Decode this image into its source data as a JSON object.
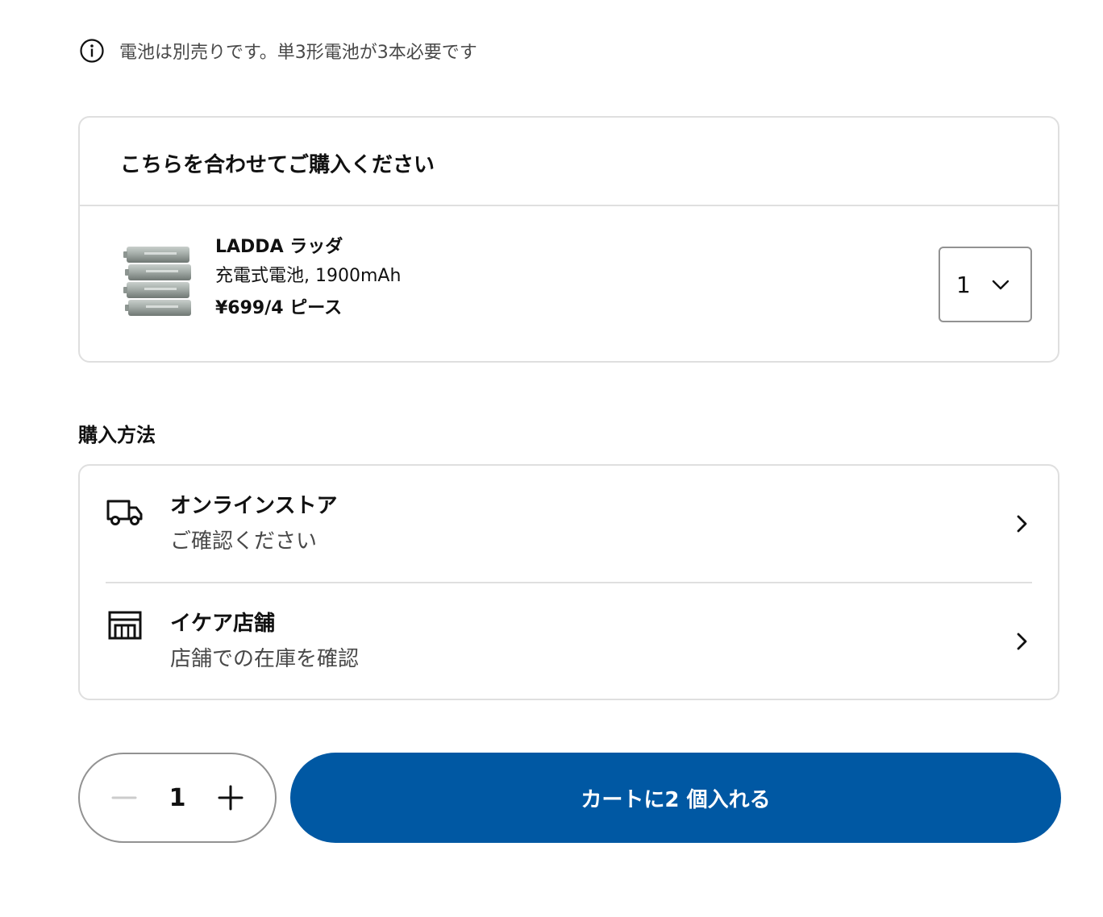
{
  "notice": {
    "icon": "info-icon",
    "text": "電池は別売りです。単3形電池が3本必要です"
  },
  "addon": {
    "title": "こちらを合わせてご購入ください",
    "product": {
      "name": "LADDA ラッダ",
      "description": "充電式電池, 1900mAh",
      "price": "¥699/4 ピース",
      "quantity": "1"
    }
  },
  "purchase": {
    "title": "購入方法",
    "methods": [
      {
        "icon": "truck-icon",
        "title": "オンラインストア",
        "subtitle": "ご確認ください"
      },
      {
        "icon": "store-icon",
        "title": "イケア店舗",
        "subtitle": "店舗での在庫を確認"
      }
    ]
  },
  "cart": {
    "quantity": "1",
    "button_label": "カートに2 個入れる",
    "accent_color": "#0058a3"
  }
}
